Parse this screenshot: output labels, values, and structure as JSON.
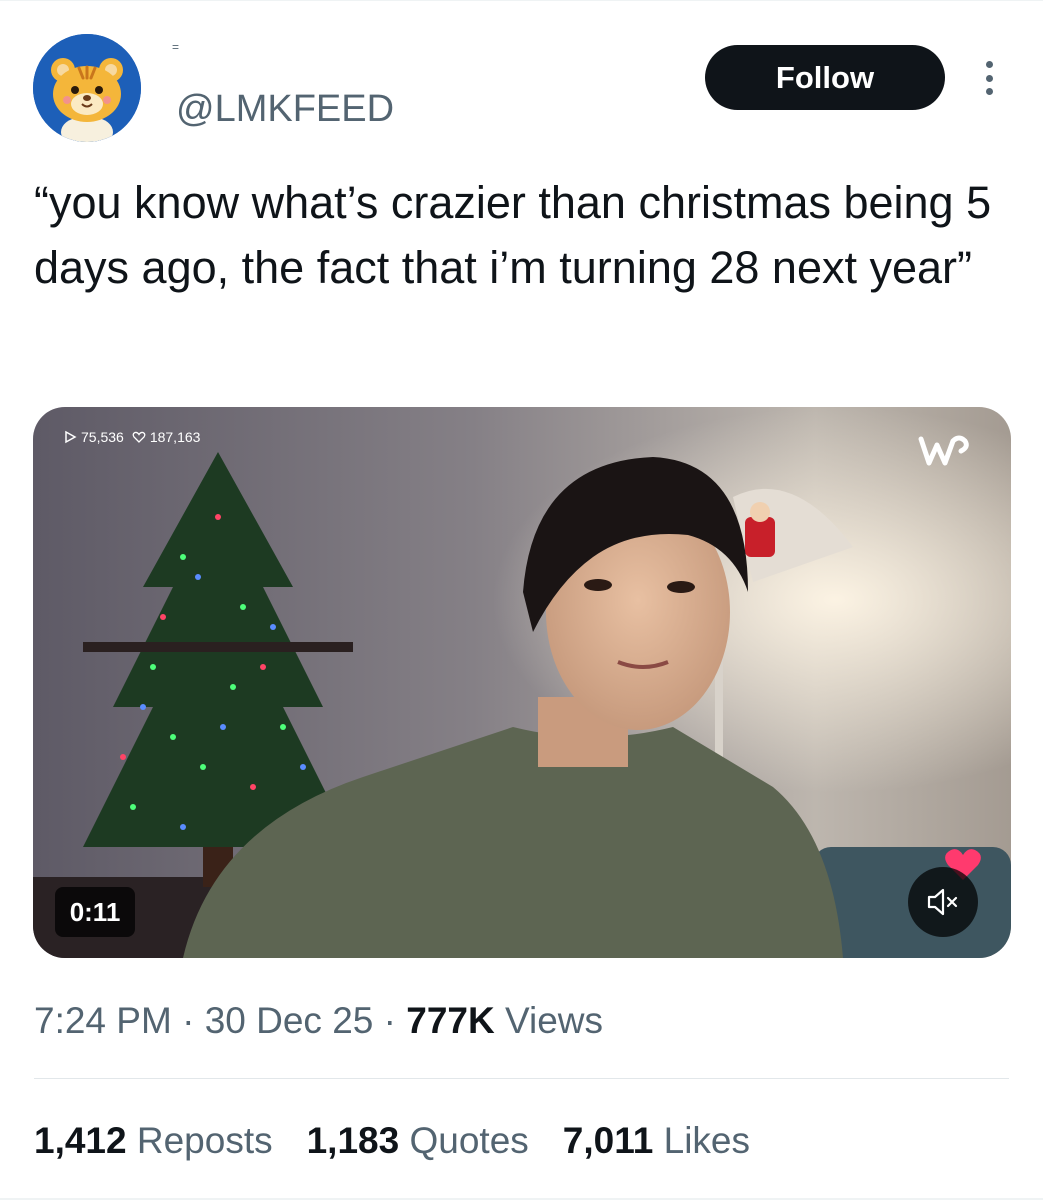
{
  "tweet": {
    "display_name": "=",
    "handle": "@LMKFEED",
    "follow_label": "Follow",
    "text": "“you know what’s crazier than christmas being 5 days ago, the fact that i’m turning 28 next year”"
  },
  "media": {
    "stats_plays": "75,536",
    "stats_likes": "187,163",
    "duration": "0:11",
    "watermark": "w"
  },
  "meta": {
    "time": "7:24 PM",
    "date": "30 Dec 25",
    "views_count": "777K",
    "views_label": "Views",
    "separator": "·"
  },
  "engagement": {
    "reposts_count": "1,412",
    "reposts_label": "Reposts",
    "quotes_count": "1,183",
    "quotes_label": "Quotes",
    "likes_count": "7,011",
    "likes_label": "Likes"
  },
  "colors": {
    "text_primary": "#0f1419",
    "text_secondary": "#536471",
    "follow_button": "#0f1419",
    "avatar_bg": "#1d5fb8"
  }
}
